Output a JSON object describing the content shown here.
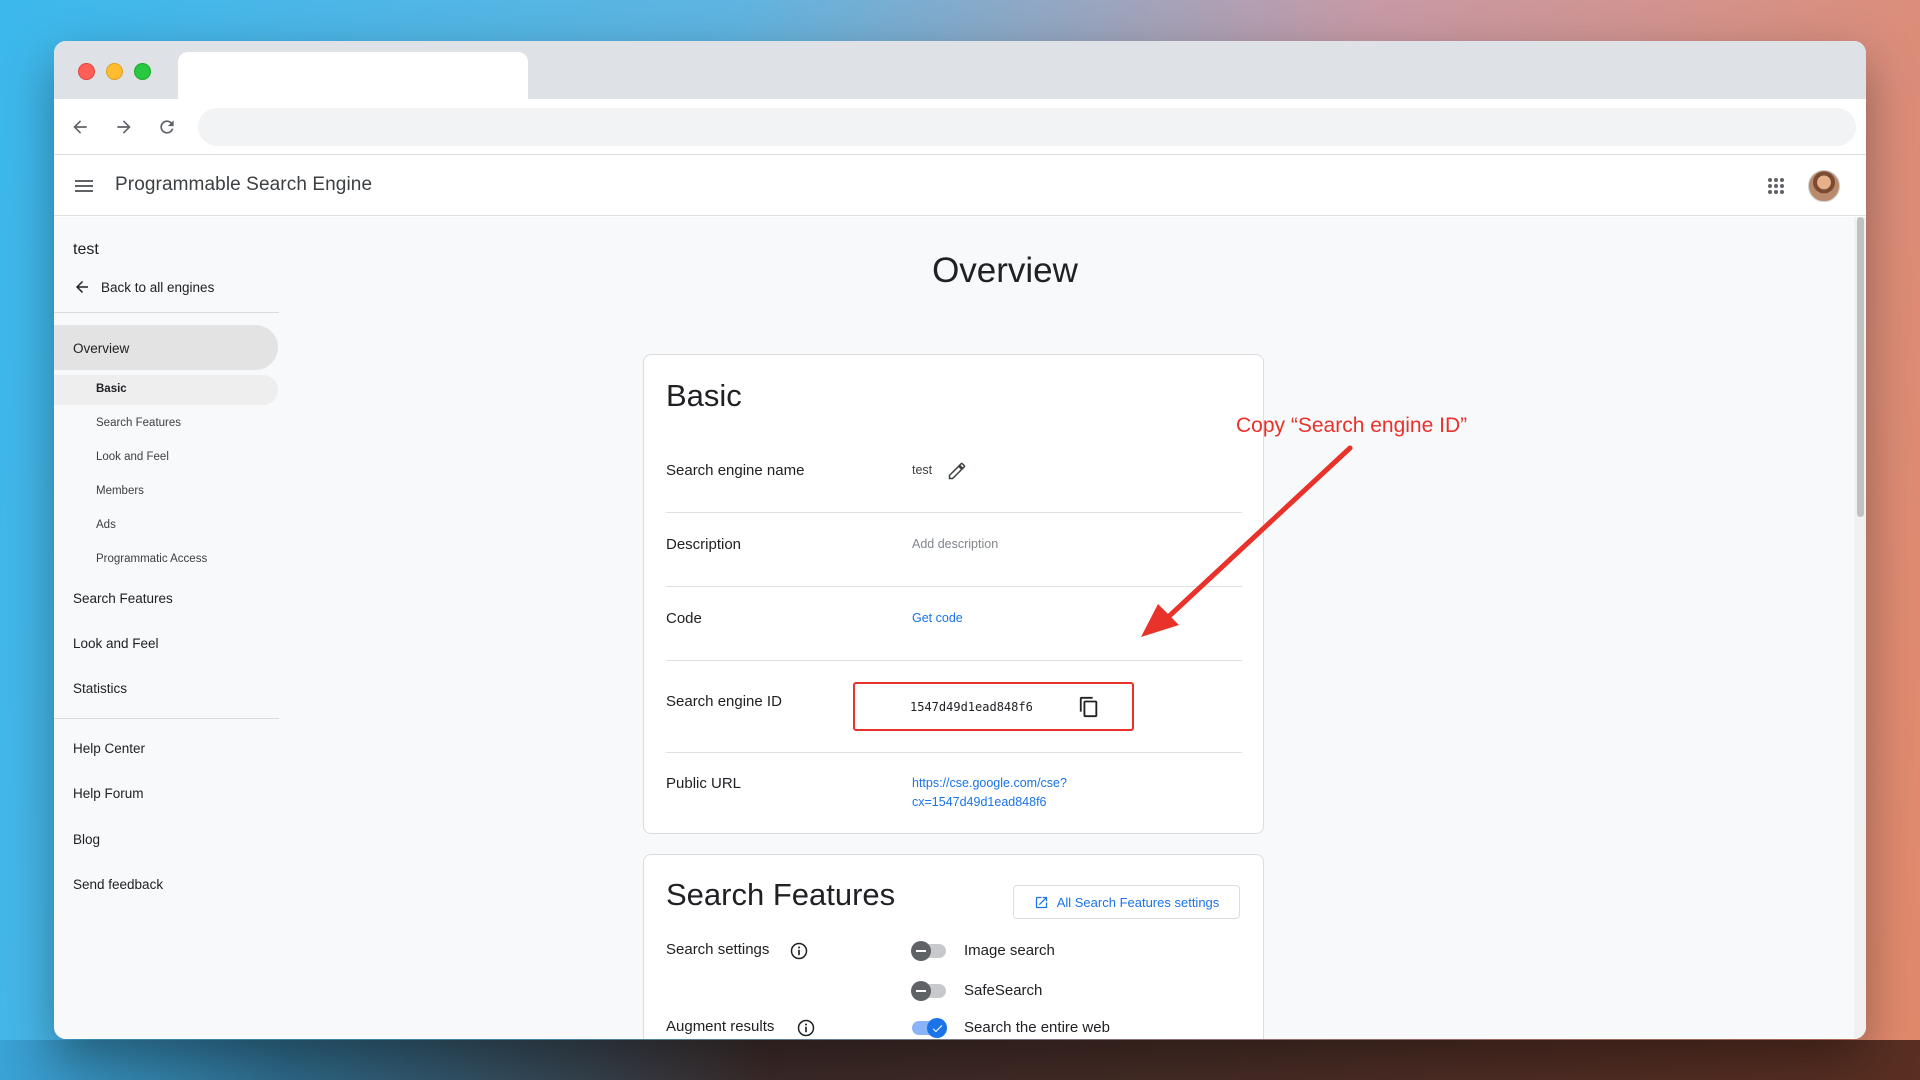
{
  "app": {
    "title": "Programmable Search Engine"
  },
  "sidebar": {
    "engine_name": "test",
    "back_label": "Back to all engines",
    "items": [
      {
        "label": "Overview",
        "active": true
      },
      {
        "label": "Search Features"
      },
      {
        "label": "Look and Feel"
      },
      {
        "label": "Statistics"
      }
    ],
    "subitems": [
      {
        "label": "Basic",
        "active": true
      },
      {
        "label": "Search Features"
      },
      {
        "label": "Look and Feel"
      },
      {
        "label": "Members"
      },
      {
        "label": "Ads"
      },
      {
        "label": "Programmatic Access"
      }
    ],
    "footer_links": [
      "Help Center",
      "Help Forum",
      "Blog",
      "Send feedback"
    ]
  },
  "main": {
    "title": "Overview",
    "basic": {
      "heading": "Basic",
      "rows": {
        "name": {
          "label": "Search engine name",
          "value": "test"
        },
        "description": {
          "label": "Description",
          "placeholder": "Add description"
        },
        "code": {
          "label": "Code",
          "link": "Get code"
        },
        "engine_id": {
          "label": "Search engine ID",
          "value": "1547d49d1ead848f6"
        },
        "public_url": {
          "label": "Public URL",
          "line1": "https://cse.google.com/cse?",
          "line2": "cx=1547d49d1ead848f6"
        }
      }
    },
    "search_features": {
      "heading": "Search Features",
      "settings_button": "All Search Features settings",
      "search_settings_label": "Search settings",
      "augment_label": "Augment results",
      "toggles": [
        {
          "label": "Image search",
          "on": false
        },
        {
          "label": "SafeSearch",
          "on": false
        },
        {
          "label": "Search the entire web",
          "on": true
        }
      ]
    }
  },
  "annotation": {
    "text": "Copy “Search engine ID”",
    "color": "#e8322a"
  },
  "colors": {
    "accent": "#1a73e8",
    "highlight": "#e8322a"
  }
}
